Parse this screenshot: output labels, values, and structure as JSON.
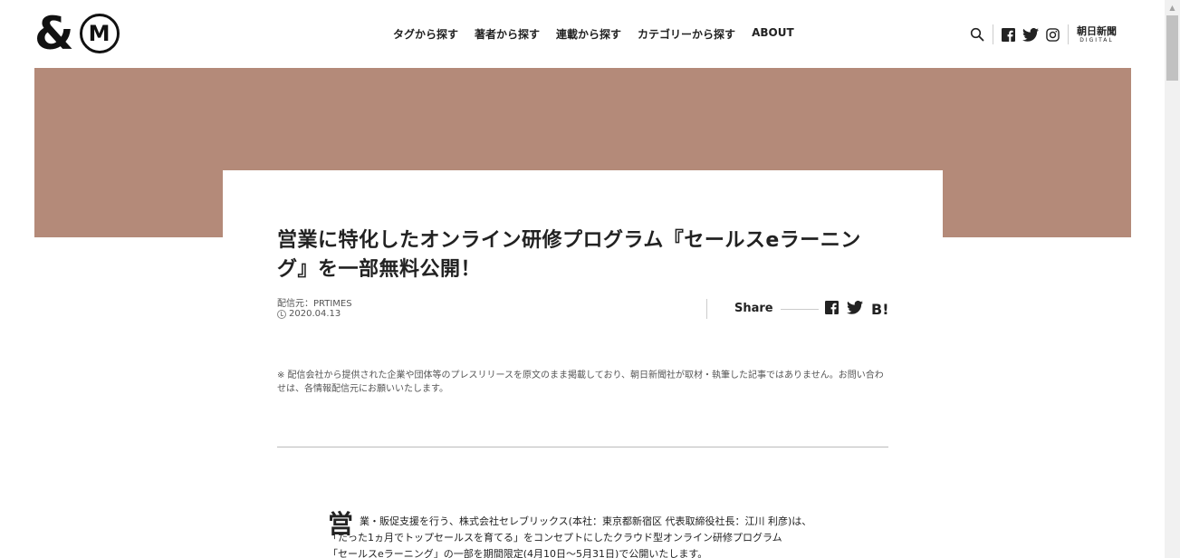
{
  "logo": {
    "amp": "&",
    "m": "M"
  },
  "nav": [
    {
      "label": "タグから探す"
    },
    {
      "label": "著者から探す"
    },
    {
      "label": "連載から探す"
    },
    {
      "label": "カテゴリーから探す"
    },
    {
      "label": "ABOUT"
    }
  ],
  "header_icons": [
    "search-icon",
    "facebook-icon",
    "twitter-icon",
    "instagram-icon"
  ],
  "asahi": {
    "name": "朝日新聞",
    "sub": "DIGITAL"
  },
  "colors": {
    "hero": "#b48a79",
    "text": "#222222"
  },
  "article": {
    "title": "営業に特化したオンライン研修プログラム『セールスeラーニング』を一部無料公開！",
    "source": "配信元：PRTIMES",
    "date": "2020.04.13",
    "share_label": "Share",
    "hatena": "B!",
    "notice": "※ 配信会社から提供された企業や団体等のプレスリリースを原文のまま掲載しており、朝日新聞社が取材・執筆した記事ではありません。お問い合わせは、各情報配信元にお願いいたします。",
    "dropcap": "営",
    "body_lines": [
      "業・販促支援を行う、株式会社セレブリックス(本社：東京都新宿区 代表取締役社長：江川 利彦)は、",
      "「たった1ヵ月でトップセールスを育てる」をコンセプトにしたクラウド型オンライン研修プログラム",
      "「セールスeラーニング」の一部を期間限定(4月10日〜5月31日)で公開いたします。"
    ]
  }
}
